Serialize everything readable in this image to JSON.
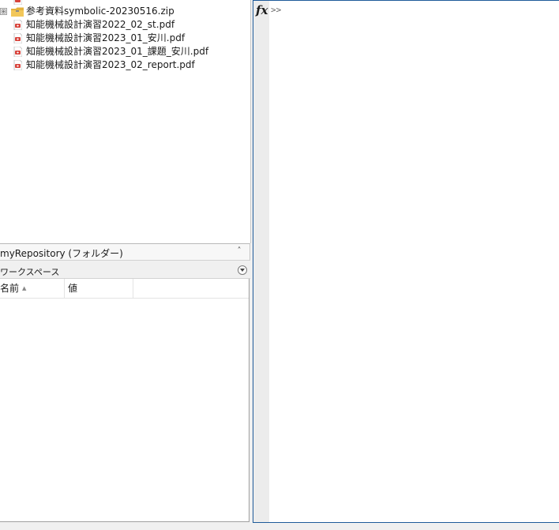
{
  "file_browser": {
    "items": [
      {
        "name": "知能機械設計演習2022_02_st.pdf",
        "type": "pdf"
      },
      {
        "name": "知能機械設計演習2023_01_安川.pdf",
        "type": "pdf"
      },
      {
        "name": "知能機械設計演習2023_01_課題_安川.pdf",
        "type": "pdf"
      },
      {
        "name": "知能機械設計演習2023_02_report.pdf",
        "type": "pdf"
      }
    ],
    "zip_item": {
      "name": "参考資料symbolic-20230516.zip",
      "expander": "⊞"
    }
  },
  "folder_bar": {
    "title": "myRepository  (フォルダー)",
    "collapse_glyph": "˄"
  },
  "workspace": {
    "title": "ワークスペース",
    "columns": [
      {
        "label": "名前",
        "sort_glyph": "▲"
      },
      {
        "label": "値"
      }
    ]
  },
  "command_window": {
    "fx_label": "fx",
    "prompt": ">>"
  },
  "colors": {
    "accent_border": "#1f5b9a",
    "pdf_icon": "#d8443c",
    "zip_icon": "#e3b13b"
  }
}
